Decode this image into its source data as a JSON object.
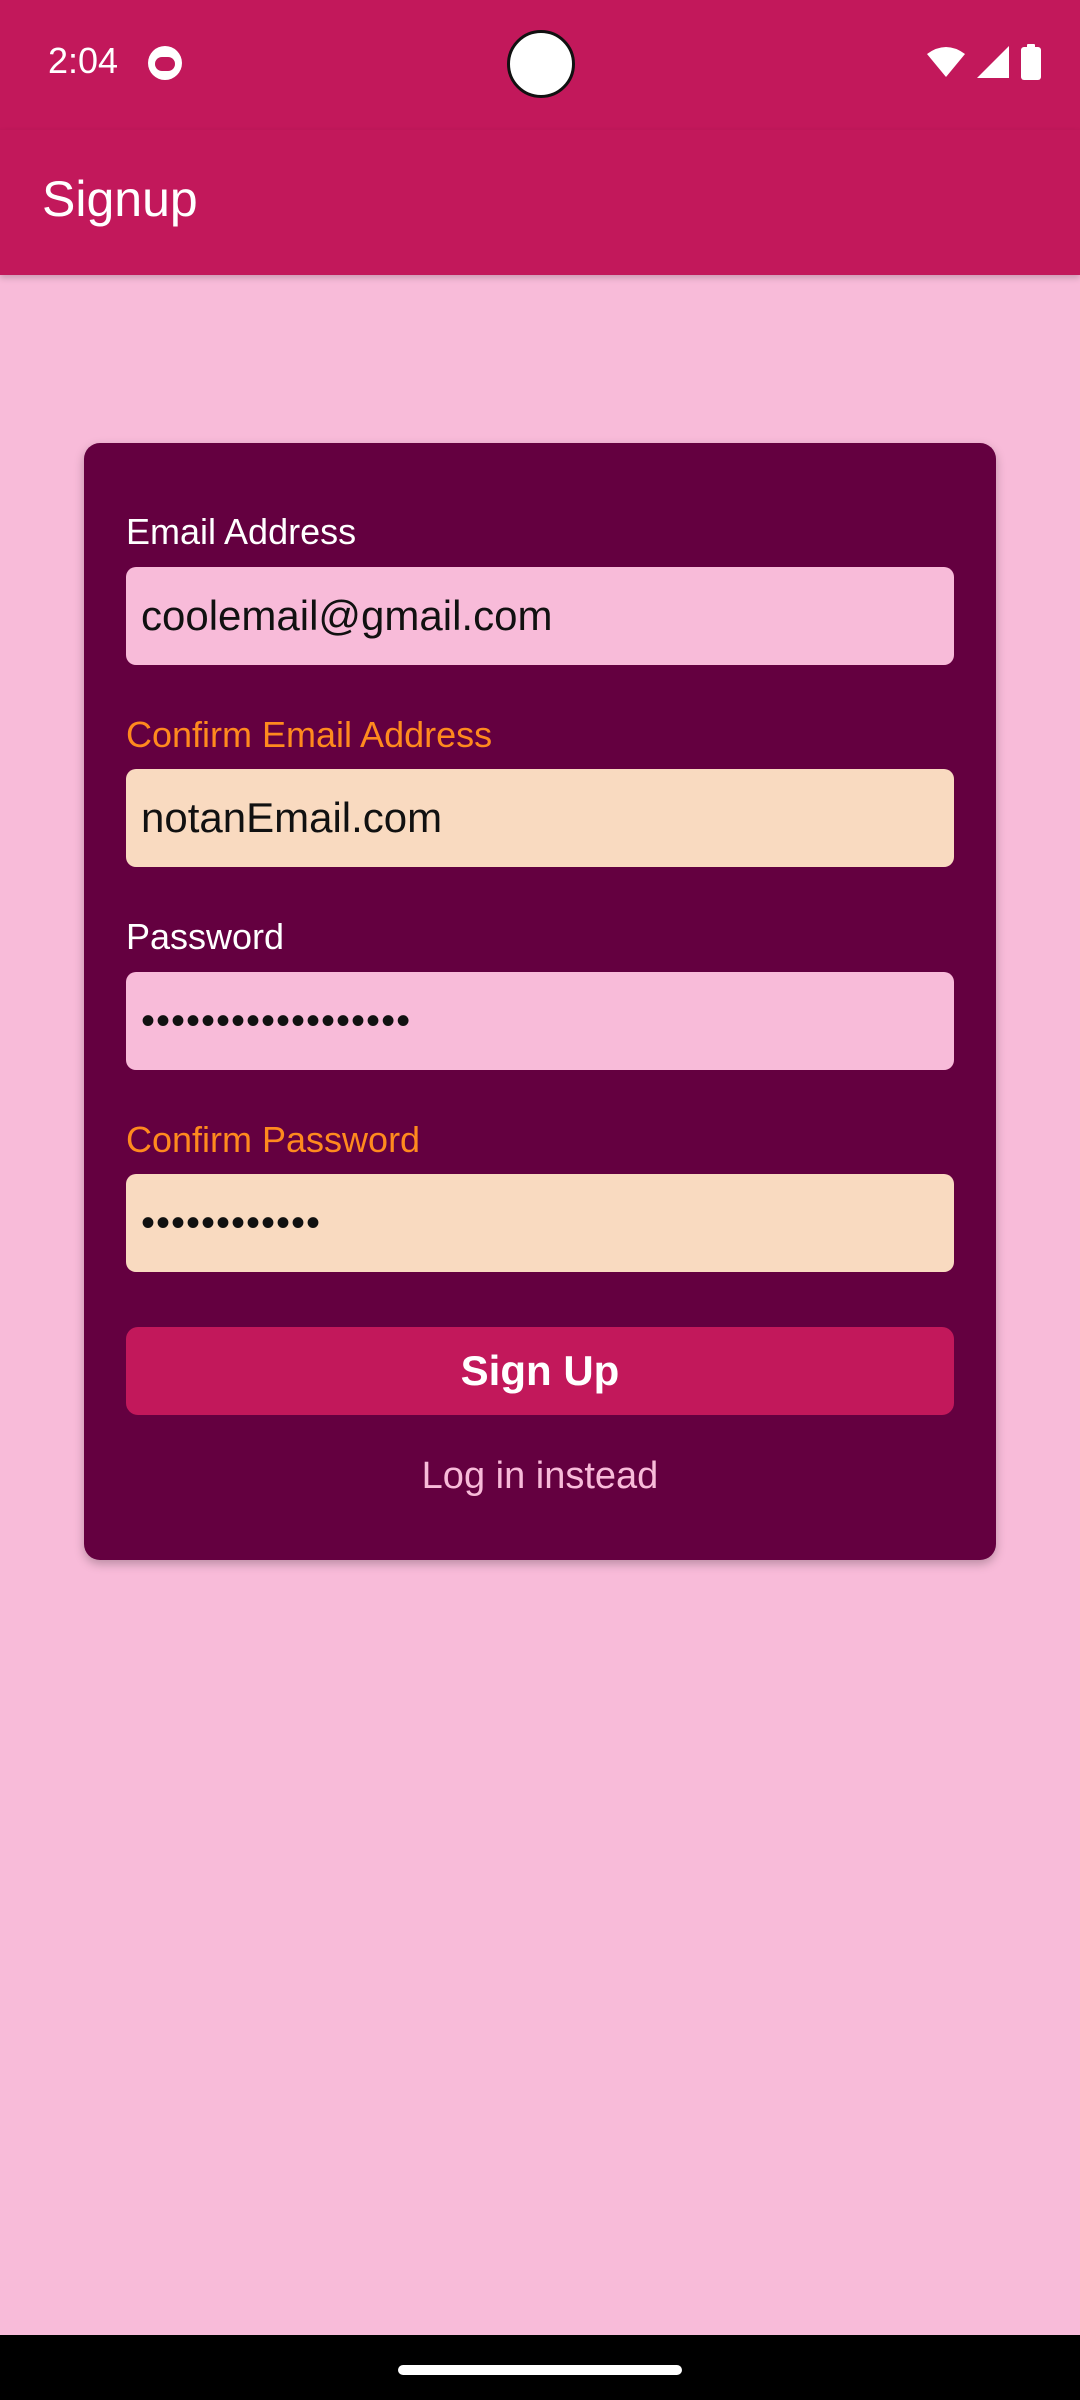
{
  "status_bar": {
    "time": "2:04",
    "icons": [
      "notification-icon",
      "wifi-icon",
      "signal-icon",
      "battery-icon"
    ]
  },
  "app_bar": {
    "title": "Signup"
  },
  "form": {
    "email": {
      "label": "Email Address",
      "value": "coolemail@gmail.com",
      "state": "normal"
    },
    "confirm_email": {
      "label": "Confirm Email Address",
      "value": "notanEmail.com",
      "state": "error"
    },
    "password": {
      "label": "Password",
      "value": "••••••••••••••••••",
      "state": "normal"
    },
    "confirm_password": {
      "label": "Confirm Password",
      "value": "••••••••••••",
      "state": "error"
    },
    "signup_button": "Sign Up",
    "login_link": "Log in instead"
  },
  "colors": {
    "primary": "#C2185B",
    "background": "#F8BBD9",
    "card": "#640040",
    "error_text": "#FF8A1E",
    "error_field": "#F9DAC0"
  }
}
